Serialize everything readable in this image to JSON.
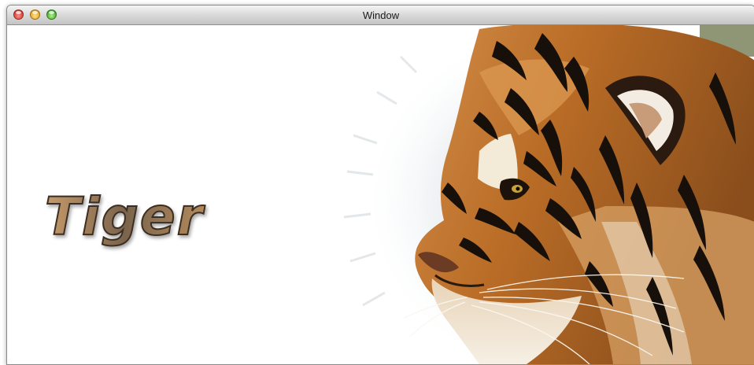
{
  "window": {
    "title": "Window"
  },
  "content": {
    "wordmark": "Tiger"
  },
  "colors": {
    "window_background": "#ffffff",
    "tiger_orange": "#c8782f",
    "tiger_stripe": "#17100a"
  },
  "icons": [
    "close-button",
    "minimize-button",
    "zoom-button"
  ]
}
